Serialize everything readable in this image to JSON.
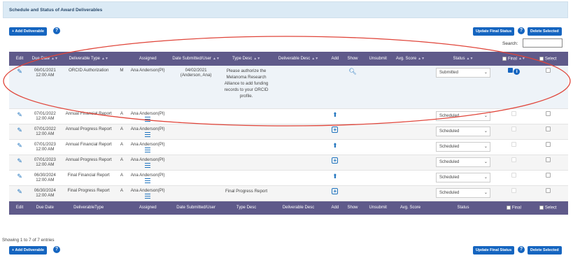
{
  "page": {
    "title": "Schedule and Status of Award Deliverables"
  },
  "toolbar": {
    "add_label": "+ Add Deliverable",
    "update_label": "Update Final Status",
    "delete_label": "Delete Selected",
    "search_label": "Search:",
    "search_value": ""
  },
  "table": {
    "headers": [
      "Edit",
      "Due Date",
      "Deliverable Type",
      "",
      "Assigned",
      "Date Submitted/User",
      "Type Desc",
      "Deliverable Desc",
      "Add",
      "Show",
      "Unsubmit",
      "Avg. Score",
      "Status",
      "Final",
      "Select"
    ],
    "footers": [
      "Edit",
      "Due Date",
      "DeliverableType",
      "",
      "Assigned",
      "Date Submitted/User",
      "Type Desc",
      "Deliverable Desc",
      "Add",
      "Show",
      "Unsubmit",
      "Avg. Score",
      "Status",
      "Final",
      "Select"
    ],
    "rows": [
      {
        "due": "06/01/2021",
        "time": "12:00 AM",
        "type": "ORCID Authorization",
        "code": "M",
        "assigned": "Ana Anderson(PI)",
        "submitted": "04/02/2021",
        "user": "(Anderson, Ana)",
        "desc": "Please authorize the Melanoma Research Alliance to add funding records to your ORCID profile.",
        "status": "Submitted",
        "add": "",
        "show": "search",
        "final": "checked"
      },
      {
        "due": "07/01/2022",
        "time": "12:00 AM",
        "type": "Annual Financial Report",
        "code": "A",
        "assigned": "Ana Anderson(PI)",
        "submitted": "",
        "user": "",
        "desc": "",
        "status": "Scheduled",
        "add": "upload",
        "show": "",
        "final": "disabled"
      },
      {
        "due": "07/01/2022",
        "time": "12:00 AM",
        "type": "Annual Progress Report",
        "code": "A",
        "assigned": "Ana Anderson(PI)",
        "submitted": "",
        "user": "",
        "desc": "",
        "status": "Scheduled",
        "add": "plus",
        "show": "",
        "final": "disabled"
      },
      {
        "due": "07/01/2023",
        "time": "12:00 AM",
        "type": "Annual Financial Report",
        "code": "A",
        "assigned": "Ana Anderson(PI)",
        "submitted": "",
        "user": "",
        "desc": "",
        "status": "Scheduled",
        "add": "upload",
        "show": "",
        "final": "disabled"
      },
      {
        "due": "07/01/2023",
        "time": "12:00 AM",
        "type": "Annual Progress Report",
        "code": "A",
        "assigned": "Ana Anderson(PI)",
        "submitted": "",
        "user": "",
        "desc": "",
        "status": "Scheduled",
        "add": "plus",
        "show": "",
        "final": "disabled"
      },
      {
        "due": "06/30/2024",
        "time": "12:00 AM",
        "type": "Final Financial Report",
        "code": "A",
        "assigned": "Ana Anderson(PI)",
        "submitted": "",
        "user": "",
        "desc": "",
        "status": "Scheduled",
        "add": "upload",
        "show": "",
        "final": "disabled"
      },
      {
        "due": "06/30/2024",
        "time": "12:00 AM",
        "type": "Final Progress Report",
        "code": "A",
        "assigned": "Ana Anderson(PI)",
        "submitted": "",
        "user": "",
        "desc": "Final Progress Report",
        "status": "Scheduled",
        "add": "plus",
        "show": "",
        "final": "disabled"
      }
    ]
  },
  "footer": {
    "info": "Showing 1 to 7 of 7 entries"
  },
  "colors": {
    "header_bg": "#5f5a8a",
    "button": "#1565c0",
    "annotation": "#e0453a"
  }
}
